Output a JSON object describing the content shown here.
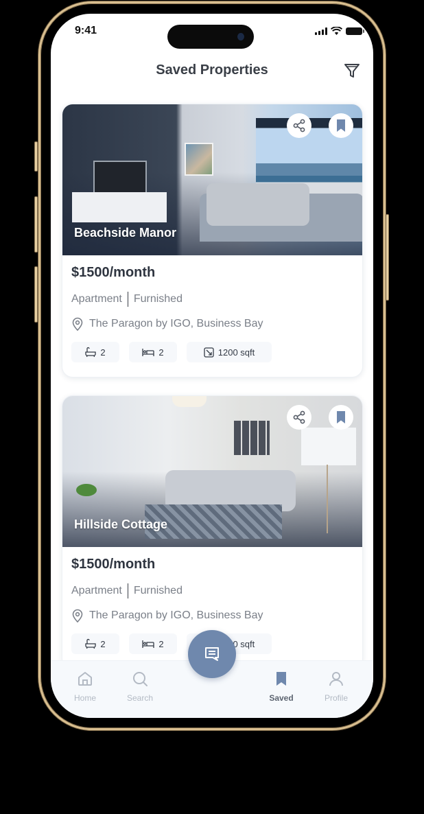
{
  "status_bar": {
    "time": "9:41"
  },
  "header": {
    "title": "Saved Properties",
    "filter_icon": "filter-icon"
  },
  "colors": {
    "accent": "#6f88ad",
    "title": "#3a3f47",
    "muted": "#7a7f88",
    "nav_inactive": "#b3bac4"
  },
  "properties": [
    {
      "name": "Beachside Manor",
      "price": "$1500/month",
      "type": "Apartment",
      "furnishing": "Furnished",
      "location": "The Paragon by IGO, Business Bay",
      "baths": "2",
      "beds": "2",
      "area": "1200 sqft"
    },
    {
      "name": "Hillside Cottage",
      "price": "$1500/month",
      "type": "Apartment",
      "furnishing": "Furnished",
      "location": "The Paragon by IGO, Business Bay",
      "baths": "2",
      "beds": "2",
      "area": "1200 sqft"
    }
  ],
  "nav": {
    "items": [
      {
        "label": "Home",
        "icon": "home-icon"
      },
      {
        "label": "Search",
        "icon": "search-icon"
      },
      {
        "label": "Saved",
        "icon": "bookmark-icon",
        "active": true
      },
      {
        "label": "Profile",
        "icon": "profile-icon"
      }
    ],
    "fab_icon": "chat-icon"
  }
}
